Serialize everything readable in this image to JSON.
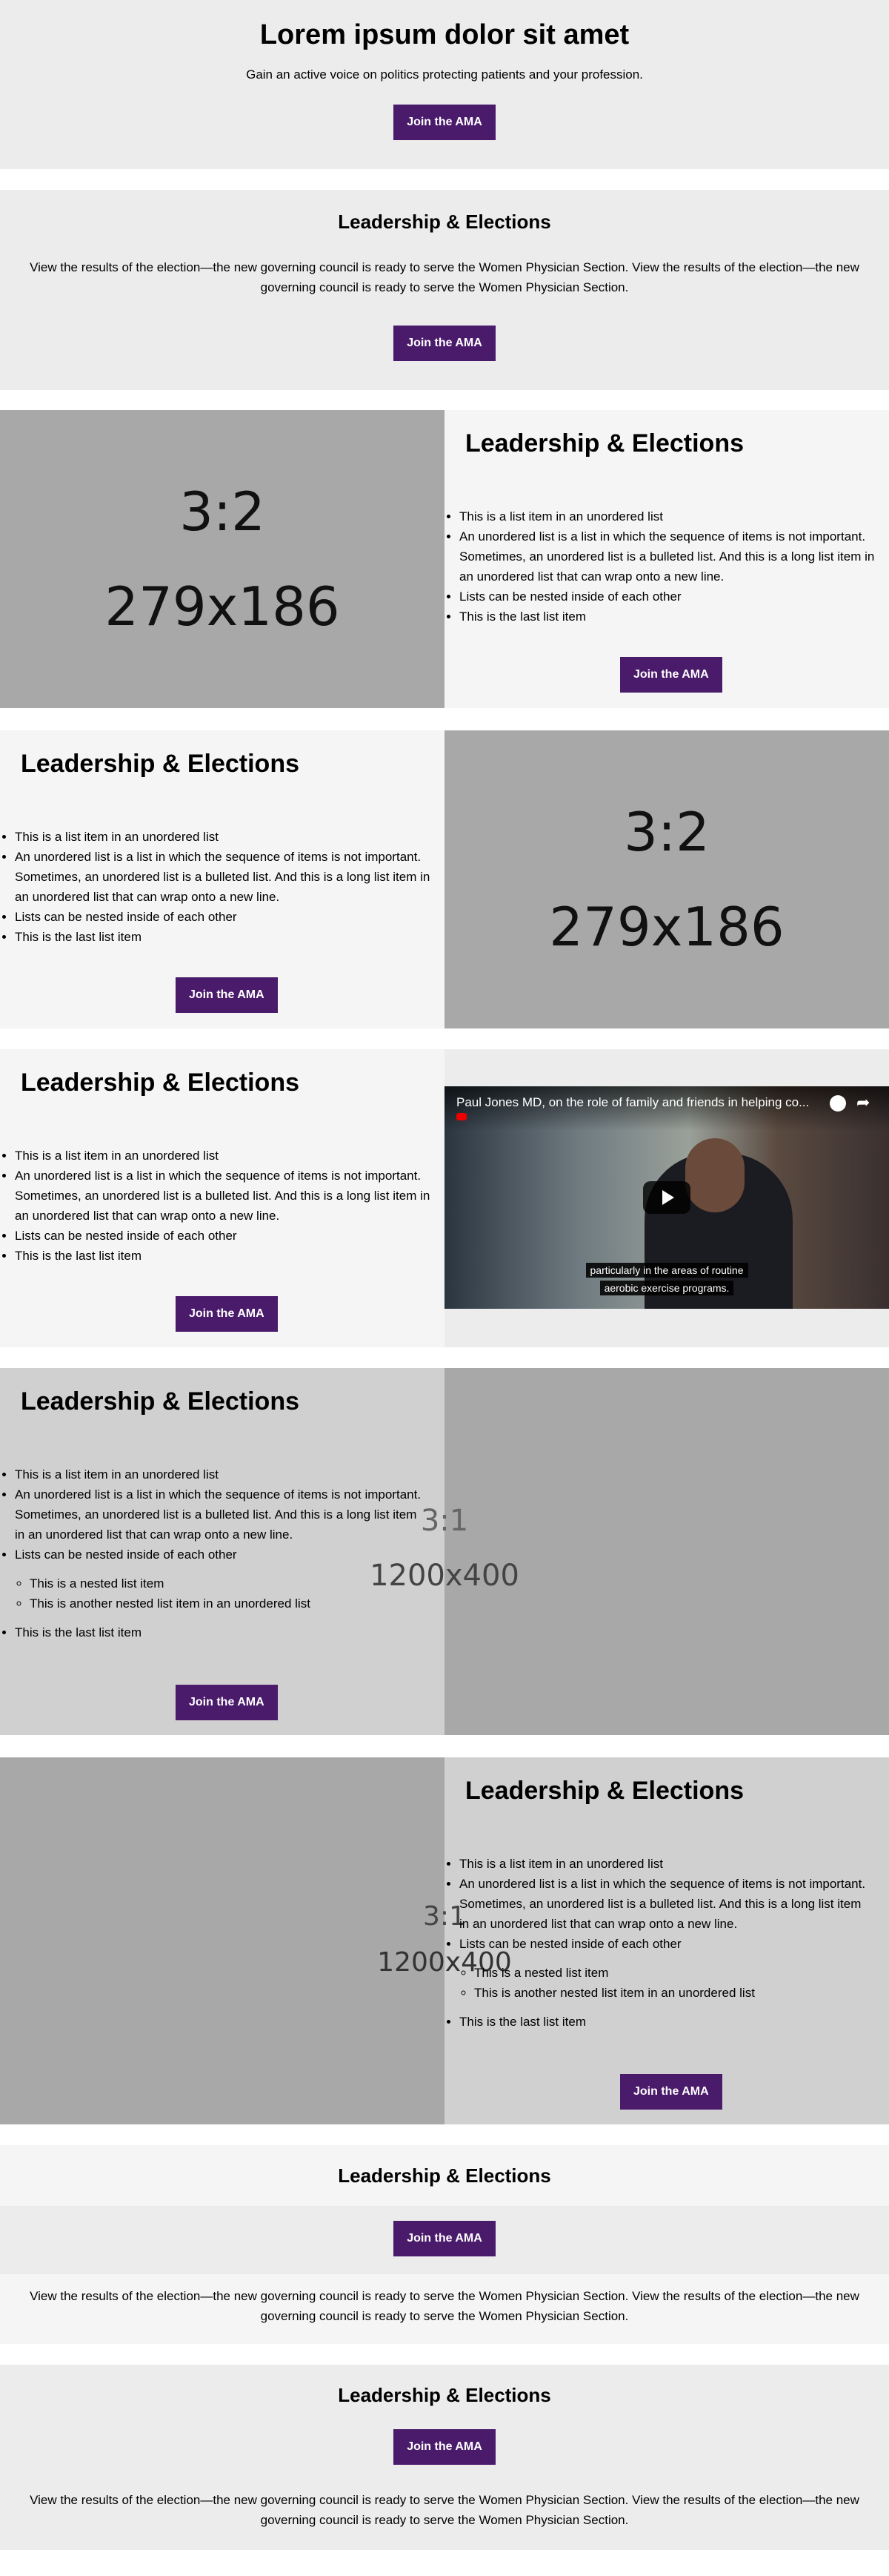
{
  "hero": {
    "title": "Lorem ipsum dolor sit amet",
    "subtitle": "Gain an active voice on politics protecting patients and your profession.",
    "button": "Join the AMA"
  },
  "section2": {
    "title": "Leadership & Elections",
    "body": "View the results of the election—the new governing council is ready to serve the Women Physician Section. View the results of the election—the new governing council is ready to serve the Women Physician Section.",
    "button": "Join the AMA"
  },
  "list_heading": "Leadership & Elections",
  "list_simple": [
    "This is a list item in an unordered list",
    "An unordered list is a list in which the sequence of items is not important. Sometimes, an unordered list is a bulleted list. And this is a long list item in an unordered list that can wrap onto a new line.",
    "Lists can be nested inside of each other",
    "This is the last list item"
  ],
  "list_nested": {
    "items_before": [
      "This is a list item in an unordered list",
      "An unordered list is a list in which the sequence of items is not important. Sometimes, an unordered list is a bulleted list. And this is a long list item in an unordered list that can wrap onto a new line.",
      "Lists can be nested inside of each other"
    ],
    "nested": [
      "This is a nested list item",
      "This is another nested list item in an unordered list"
    ],
    "last": "This is the last list item"
  },
  "button": "Join the AMA",
  "placeholder_small": {
    "ratio": "3:2",
    "size": "279x186"
  },
  "placeholder_wide": {
    "ratio": "3:1",
    "size": "1200x400"
  },
  "video": {
    "title": "Paul Jones MD, on the role of family and friends in helping co...",
    "caption_line1": "particularly in the areas of routine",
    "caption_line2": "aerobic exercise programs."
  },
  "section8": {
    "title": "Leadership & Elections",
    "button": "Join the AMA",
    "body": "View the results of the election—the new governing council is ready to serve the Women Physician Section. View the results of the election—the new governing council is ready to serve the Women Physician Section."
  },
  "section9": {
    "title": "Leadership & Elections",
    "button": "Join the AMA",
    "body": "View the results of the election—the new governing council is ready to serve the Women Physician Section. View the results of the election—the new governing council is ready to serve the Women Physician Section."
  },
  "colors": {
    "purple": "#4a1a6b",
    "light_gray": "#ececec",
    "lighter_gray": "#f5f5f5",
    "placeholder": "#a8a8a8"
  }
}
